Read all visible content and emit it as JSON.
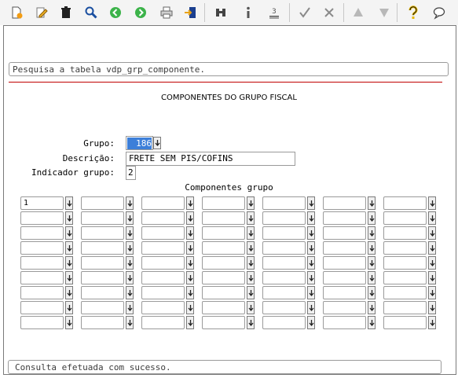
{
  "toolbar": {
    "icons": [
      "new-document-icon",
      "edit-pencil-icon",
      "trash-icon",
      "search-magnifier-icon",
      "previous-record-icon",
      "next-record-icon",
      "print-icon",
      "exit-icon",
      "binoculars-icon",
      "info-icon",
      "numbered-list-icon",
      "confirm-check-icon",
      "cancel-icon",
      "move-up-icon",
      "move-down-icon",
      "help-icon",
      "chat-icon"
    ]
  },
  "search": {
    "text": "Pesquisa a tabela vdp_grp_componente."
  },
  "form": {
    "title": "COMPONENTES DO GRUPO FISCAL",
    "grupo_label": "Grupo:",
    "grupo_value": "186",
    "descricao_label": "Descrição:",
    "descricao_value": "FRETE SEM PIS/COFINS",
    "indicador_label": "Indicador grupo:",
    "indicador_value": "2"
  },
  "grid": {
    "title": "Componentes grupo",
    "columns": 7,
    "rows": 9,
    "values": [
      [
        "1",
        "",
        "",
        "",
        "",
        "",
        ""
      ],
      [
        "",
        "",
        "",
        "",
        "",
        "",
        ""
      ],
      [
        "",
        "",
        "",
        "",
        "",
        "",
        ""
      ],
      [
        "",
        "",
        "",
        "",
        "",
        "",
        ""
      ],
      [
        "",
        "",
        "",
        "",
        "",
        "",
        ""
      ],
      [
        "",
        "",
        "",
        "",
        "",
        "",
        ""
      ],
      [
        "",
        "",
        "",
        "",
        "",
        "",
        ""
      ],
      [
        "",
        "",
        "",
        "",
        "",
        "",
        ""
      ],
      [
        "",
        "",
        "",
        "",
        "",
        "",
        ""
      ]
    ]
  },
  "status": {
    "text": "Consulta efetuada com sucesso."
  }
}
